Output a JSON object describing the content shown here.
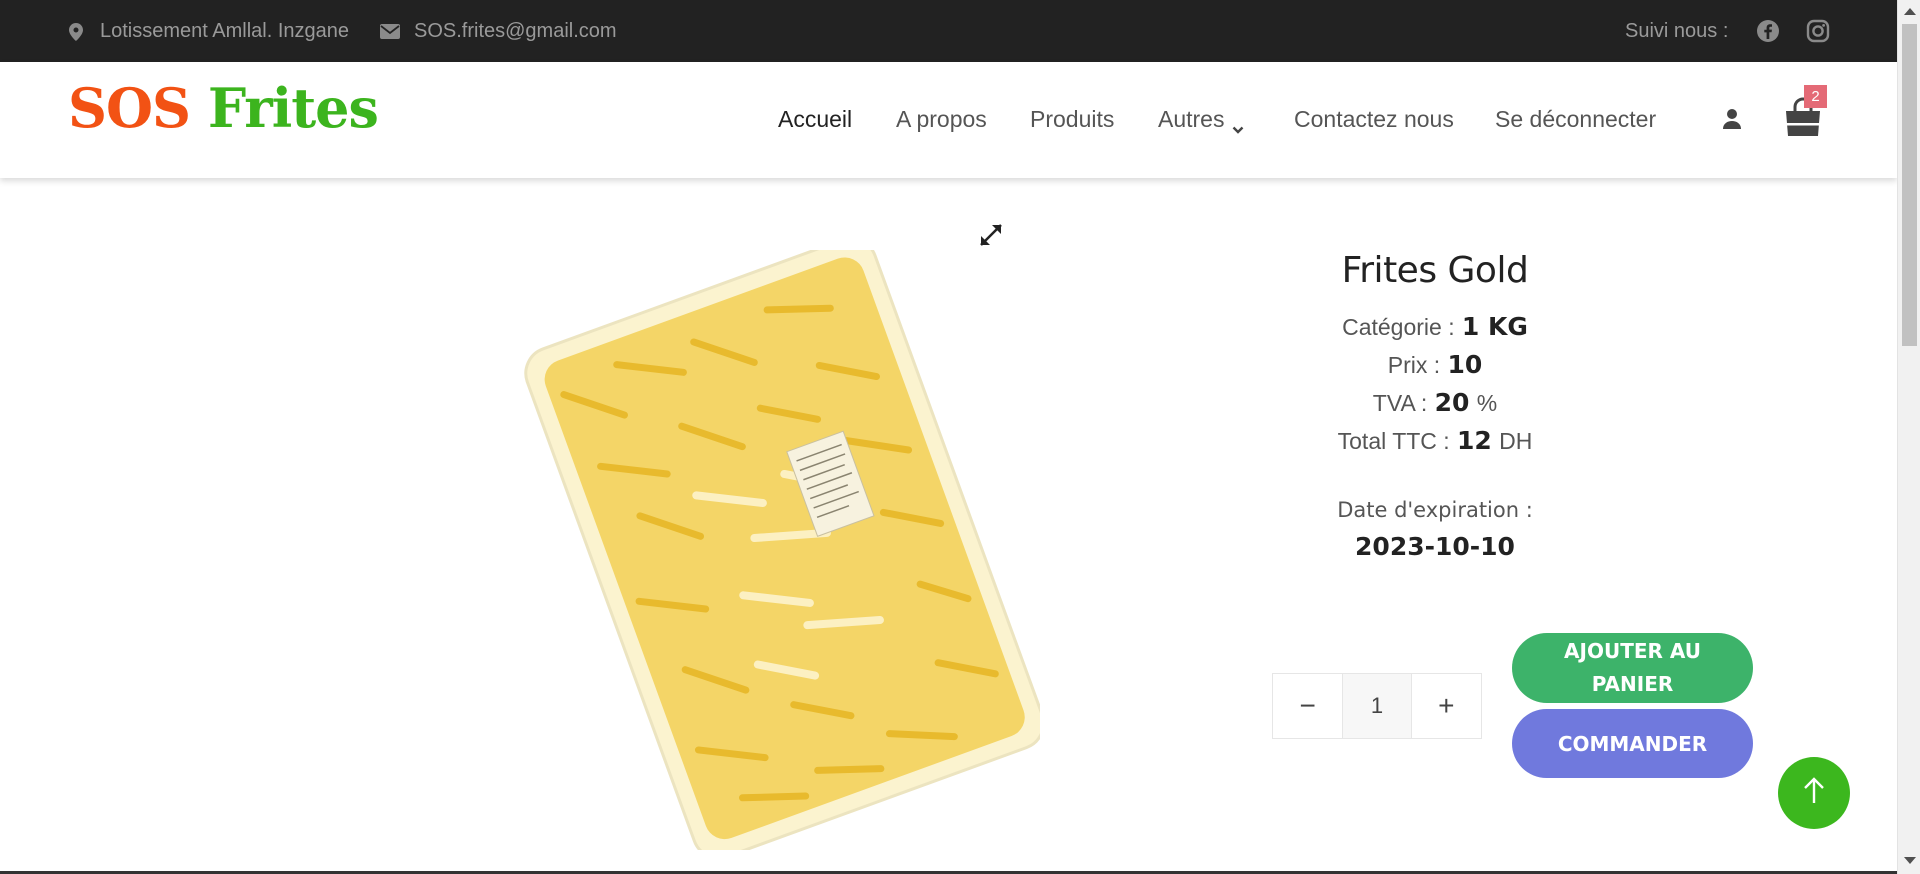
{
  "topbar": {
    "address": "Lotissement Amllal. Inzgane",
    "email": "SOS.frites@gmail.com",
    "follow_label": "Suivi nous :",
    "icons": [
      "map-marker-icon",
      "envelope-icon",
      "facebook-icon",
      "instagram-icon"
    ]
  },
  "brand": {
    "part1": "SOS",
    "part2": "Frites",
    "colors": {
      "part1": "#f25214",
      "part2": "#3cb41e"
    }
  },
  "nav": {
    "items": [
      {
        "label": "Accueil"
      },
      {
        "label": "A propos"
      },
      {
        "label": "Produits"
      },
      {
        "label": "Autres"
      },
      {
        "label": "Contactez nous"
      },
      {
        "label": "Se déconnecter"
      }
    ]
  },
  "cart": {
    "count": "2"
  },
  "product": {
    "name": "Frites Gold",
    "category_label": "Catégorie :",
    "category": "1 KG",
    "price_label": "Prix :",
    "price": "10",
    "tva_label": "TVA :",
    "tva": "20",
    "tva_unit": "%",
    "total_label": "Total TTC :",
    "total": "12",
    "currency": "DH",
    "expiry_label": "Date d'expiration :",
    "expiry": "2023-10-10"
  },
  "quantity": {
    "minus": "−",
    "value": "1",
    "plus": "+"
  },
  "actions": {
    "add_to_cart": "AJOUTER AU PANIER",
    "order": "COMMANDER"
  },
  "colors": {
    "topbar_bg": "#222222",
    "add_button": "#3db36a",
    "order_button": "#7079dd",
    "back_to_top": "#3cb71e",
    "badge": "#e46a76"
  }
}
